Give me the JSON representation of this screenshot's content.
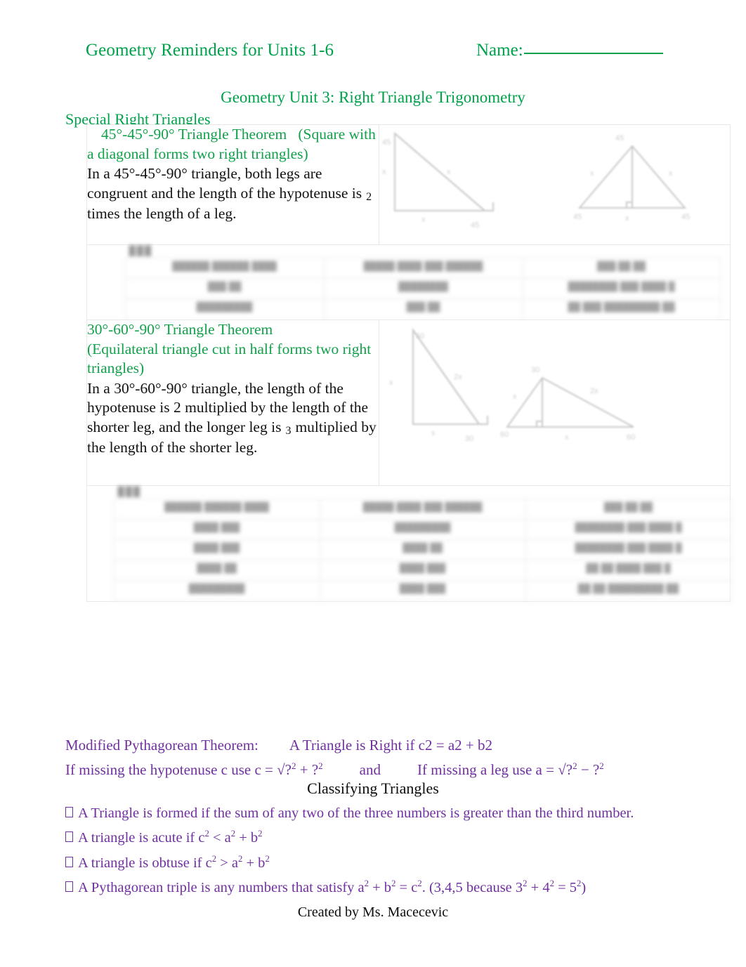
{
  "header": {
    "doc_title": "Geometry Reminders for Units 1-6",
    "name_label": "Name:"
  },
  "unit_title": "Geometry Unit 3: Right Triangle Trigonometry",
  "section_label": "Special Right Triangles",
  "theorems": [
    {
      "heading": "45°-45°-90° Triangle Theorem",
      "heading_paren": "(Square with a diagonal forms two right triangles)",
      "body_part1": "In a 45°-45°-90° triangle, both legs are congruent and the length of the hypotenuse is",
      "radicand": "2",
      "body_part2": "times the length of a leg."
    },
    {
      "heading": "30°-60°-90° Triangle Theorem",
      "heading_paren": "(Equilateral triangle cut in half forms two right triangles)",
      "body_part1": "In a 30°-60°-90° triangle, the length of the hypotenuse is 2 multiplied by the length of the shorter leg, and the longer leg is",
      "radicand": "3",
      "body_part2": "multiplied by the length of the shorter leg."
    }
  ],
  "diagrams": {
    "cell_1_name": "45-45-90 triangle illustrations",
    "cell_2_name": "30-60-90 triangle illustrations"
  },
  "blur_table_1": {
    "caption": "███",
    "rows": [
      [
        "██████ ██████ ████",
        "█████ ████ ███ ██████",
        "███ ██ ██"
      ],
      [
        "███ ██",
        "████████",
        "████████ ███ ████ █"
      ],
      [
        "█████████",
        "███ ██",
        "██ ███ █████████ ██"
      ]
    ]
  },
  "blur_table_2": {
    "caption": "███",
    "rows": [
      [
        "██████ ██████ ████",
        "█████ ████ ███ ██████",
        "███ ██ ██"
      ],
      [
        "████ ███",
        "█████████",
        "████████ ███ ████ █"
      ],
      [
        "████ ███",
        "████ ██",
        "████████ ███ ████ █"
      ],
      [
        "████ ██",
        "████ ███",
        "██ ██ ████ ███ █"
      ],
      [
        "█████████",
        "████ ███",
        "██ ██ █████████ ██"
      ]
    ]
  },
  "pythagorean": {
    "line1_label": "Modified Pythagorean Theorem:",
    "line1_text": "A Triangle is Right if c2 = a2 + b2",
    "line2_a": "If missing the hypotenuse c use c = √?",
    "line2_a_sup1": "2",
    "line2_a_mid": "+",
    "line2_a_q2": "?",
    "line2_a_sup2": "2",
    "and": "and",
    "line2_b": "If missing a leg use a = √?",
    "line2_b_sup1": "2",
    "line2_b_mid": "−",
    "line2_b_q2": "?",
    "line2_b_sup2": "2"
  },
  "classifying": {
    "heading": "Classifying Triangles",
    "bullets": [
      {
        "segments": [
          {
            "t": "A Triangle is formed if the sum of any two of the three numbers is greater than the third number."
          }
        ]
      },
      {
        "segments": [
          {
            "t": "A triangle is acute if c"
          },
          {
            "t": "2",
            "sup": true
          },
          {
            "t": " < a"
          },
          {
            "t": "2",
            "sup": true
          },
          {
            "t": " + b"
          },
          {
            "t": "2",
            "sup": true
          }
        ]
      },
      {
        "segments": [
          {
            "t": "A triangle is obtuse if c"
          },
          {
            "t": "2",
            "sup": true
          },
          {
            "t": " > a"
          },
          {
            "t": "2",
            "sup": true
          },
          {
            "t": " + b"
          },
          {
            "t": "2",
            "sup": true
          }
        ]
      },
      {
        "segments": [
          {
            "t": "A Pythagorean triple is any numbers that satisfy a"
          },
          {
            "t": "2",
            "sup": true
          },
          {
            "t": " + b"
          },
          {
            "t": "2",
            "sup": true
          },
          {
            "t": " = c"
          },
          {
            "t": "2",
            "sup": true
          },
          {
            "t": ". (3,4,5 because 3"
          },
          {
            "t": "2",
            "sup": true
          },
          {
            "t": " + 4"
          },
          {
            "t": "2",
            "sup": true
          },
          {
            "t": " = 5"
          },
          {
            "t": "2",
            "sup": true
          },
          {
            "t": ")"
          }
        ]
      }
    ]
  },
  "footer": "Created by Ms. Macecevic",
  "colors": {
    "green": "#00a14b",
    "purple": "#7030a0",
    "black": "#0d0d0d",
    "border": "#e8e8e8"
  }
}
